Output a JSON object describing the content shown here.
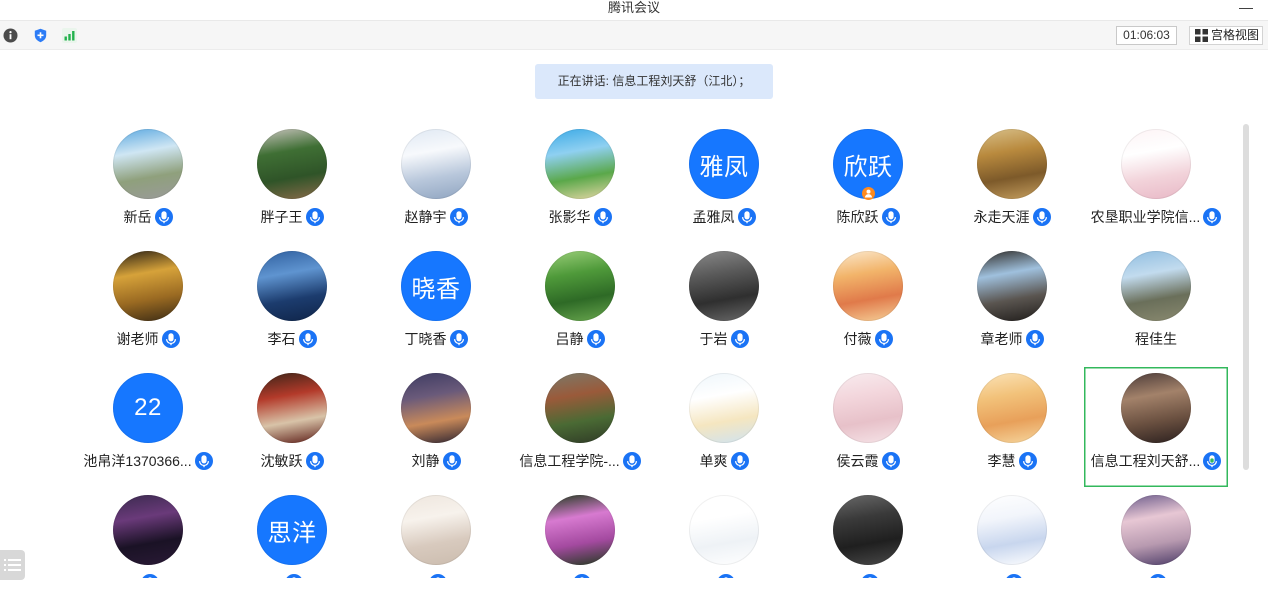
{
  "window": {
    "title": "腾讯会议",
    "minimize_label": "—"
  },
  "toolbar": {
    "icons": [
      "info-icon",
      "shield-icon",
      "signal-icon"
    ],
    "timer": "01:06:03",
    "grid_view_icon": "grid-icon",
    "grid_view_label": "宫格视图"
  },
  "banner": {
    "text": "正在讲话: 信息工程刘天舒（江北）；"
  },
  "colors": {
    "accent": "#1677ff",
    "mic": "#1a73f5",
    "speaking": "#33b85c",
    "banner_bg": "#dbe8fb",
    "host_badge": "#ff8a1f"
  },
  "participants": [
    {
      "name": "新岳",
      "colors": [
        "#5aa8e0",
        "#cfe6f3",
        "#8fa07c",
        "#9a9a9a"
      ],
      "mic": true
    },
    {
      "name": "胖子王",
      "colors": [
        "#c9c4be",
        "#3f6f34",
        "#2f5428",
        "#8a6a4a"
      ],
      "mic": true
    },
    {
      "name": "赵静宇",
      "colors": [
        "#dfe8f3",
        "#f7f9fc",
        "#b8c7db",
        "#8fa4c0"
      ],
      "mic": true
    },
    {
      "name": "张影华",
      "colors": [
        "#3aa9e6",
        "#8fd0f1",
        "#5aa84a",
        "#e8d8a8"
      ],
      "mic": true
    },
    {
      "name": "孟雅凤",
      "avatar_text": "雅凤",
      "mic": true
    },
    {
      "name": "陈欣跃",
      "avatar_text": "欣跃",
      "badge_icon": "host-icon",
      "mic": true
    },
    {
      "name": "永走天涯",
      "colors": [
        "#d8c08a",
        "#b98a3e",
        "#7d5a2a",
        "#c7a060"
      ],
      "mic": true
    },
    {
      "name": "农垦职业学院信...",
      "colors": [
        "#fdf3f5",
        "#ffffff",
        "#f2d3da",
        "#e8b8c6"
      ],
      "mic": true
    },
    {
      "name": "谢老师",
      "colors": [
        "#2a2014",
        "#d6a23a",
        "#9a6a22",
        "#3a2a14"
      ],
      "mic": true
    },
    {
      "name": "李石",
      "colors": [
        "#2f5f9e",
        "#5f94d0",
        "#1c3c6e",
        "#0f2448"
      ],
      "mic": true
    },
    {
      "name": "丁晓香",
      "avatar_text": "晓香",
      "mic": true
    },
    {
      "name": "吕静",
      "colors": [
        "#9bcf7a",
        "#4f9a3a",
        "#2e6a26",
        "#6aa84f"
      ],
      "mic": true
    },
    {
      "name": "于岩",
      "colors": [
        "#8a8a8a",
        "#5a5a5a",
        "#2f2f2f",
        "#6a6a6a"
      ],
      "mic": true
    },
    {
      "name": "付薇",
      "colors": [
        "#fbe9cf",
        "#f2b46a",
        "#e07a4a",
        "#f6d29a"
      ],
      "mic": true
    },
    {
      "name": "章老师",
      "colors": [
        "#2f2b27",
        "#9fc0dd",
        "#5a5550",
        "#1f1c1a"
      ],
      "mic": true
    },
    {
      "name": "程佳生",
      "colors": [
        "#8fbde0",
        "#c2dbee",
        "#6a6f5a",
        "#8a8a70"
      ],
      "mic": false
    },
    {
      "name": "池帛洋1370366...",
      "avatar_text": "22",
      "mic": true
    },
    {
      "name": "沈敏跃",
      "colors": [
        "#3a2418",
        "#b33a2a",
        "#d8c3a8",
        "#5a1a14"
      ],
      "mic": true
    },
    {
      "name": "刘静",
      "colors": [
        "#3d3b62",
        "#6a5a7a",
        "#c98a5a",
        "#2a2230"
      ],
      "mic": true
    },
    {
      "name": "信息工程学院-...",
      "colors": [
        "#7a7a6a",
        "#9a5a3a",
        "#4a6a34",
        "#2f3a26"
      ],
      "mic": true
    },
    {
      "name": "单爽",
      "colors": [
        "#eef6fb",
        "#ffffff",
        "#f5e6c0",
        "#cfe3f1"
      ],
      "mic": true
    },
    {
      "name": "侯云霞",
      "colors": [
        "#f8ecef",
        "#f3d6dc",
        "#e7c1c9",
        "#f6e4e8"
      ],
      "mic": true
    },
    {
      "name": "李慧",
      "colors": [
        "#fbe3b8",
        "#f2c27a",
        "#e8a05a",
        "#f6d8a0"
      ],
      "mic": true
    },
    {
      "name": "信息工程刘天舒...",
      "colors": [
        "#4a3a38",
        "#a3826a",
        "#6a5040",
        "#2a1f1e"
      ],
      "mic": true,
      "speaking": true
    },
    {
      "name": "",
      "colors": [
        "#3a2a4e",
        "#6a3a7a",
        "#1a1225",
        "#2a1a36"
      ],
      "mic": true
    },
    {
      "name": "",
      "avatar_text": "思洋",
      "mic": true
    },
    {
      "name": "",
      "colors": [
        "#eee6de",
        "#f7f2ec",
        "#d8cabe",
        "#cbbcae"
      ],
      "mic": true
    },
    {
      "name": "",
      "colors": [
        "#1e3a1a",
        "#d77ad0",
        "#a44aa0",
        "#1f3a1c"
      ],
      "mic": true
    },
    {
      "name": "",
      "colors": [
        "#ffffff",
        "#ffffff",
        "#eef2f6",
        "#ffffff"
      ],
      "mic": true
    },
    {
      "name": "",
      "colors": [
        "#6a6a6a",
        "#3a3a3a",
        "#1f1f1f",
        "#4a4a4a"
      ],
      "mic": true
    },
    {
      "name": "",
      "colors": [
        "#ffffff",
        "#f2f5fb",
        "#c8d6ee",
        "#ffffff"
      ],
      "mic": true
    },
    {
      "name": "",
      "colors": [
        "#6a5a8a",
        "#e7c7d4",
        "#b89ab0",
        "#4a3a66"
      ],
      "mic": true
    }
  ],
  "side_menu_icon": "list-icon"
}
